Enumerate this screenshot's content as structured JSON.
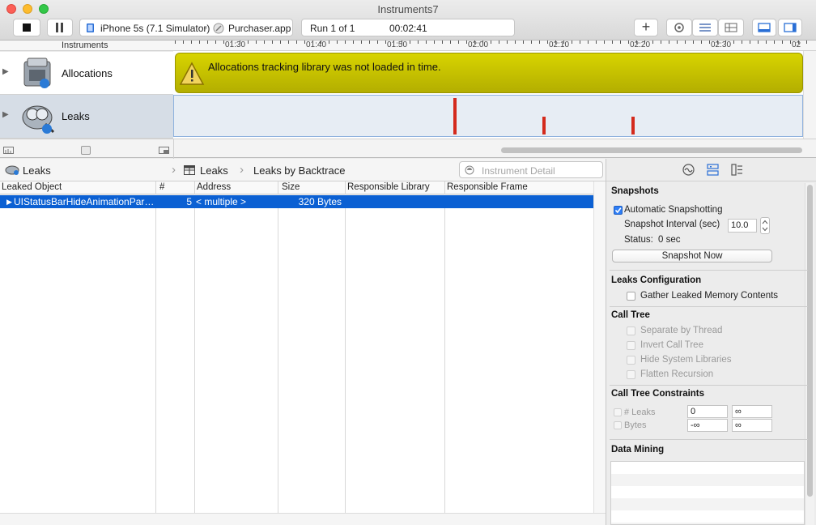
{
  "window": {
    "title": "Instruments7"
  },
  "toolbar": {
    "target_device": "iPhone 5s (7.1 Simulator)",
    "target_app": "Purchaser.app",
    "run_label": "Run 1 of 1",
    "run_time": "00:02:41",
    "add_label": "+"
  },
  "timeline": {
    "header_label": "Instruments",
    "ticks": [
      "01:30",
      "01:40",
      "01:50",
      "02:00",
      "02:10",
      "02:20",
      "02:30",
      "02"
    ]
  },
  "instruments": [
    {
      "name": "Allocations",
      "icon": "allocations-icon"
    },
    {
      "name": "Leaks",
      "icon": "leaks-icon"
    }
  ],
  "allocations_warning": "Allocations tracking library was not loaded in time.",
  "jumpbar": {
    "instrument": "Leaks",
    "view": "Leaks",
    "mode": "Leaks by Backtrace",
    "search_placeholder": "Instrument Detail"
  },
  "table": {
    "columns": [
      "Leaked Object",
      "#",
      "Address",
      "Size",
      "Responsible Library",
      "Responsible Frame"
    ],
    "rows": [
      {
        "object": "UIStatusBarHideAnimationPar…",
        "count": "5",
        "address": "< multiple >",
        "size": "320 Bytes",
        "library": "",
        "frame": ""
      }
    ]
  },
  "inspector": {
    "snapshots": {
      "title": "Snapshots",
      "auto_label": "Automatic Snapshotting",
      "auto_checked": true,
      "interval_label": "Snapshot Interval (sec)",
      "interval_value": "10.0",
      "status_label": "Status:",
      "status_value": "0 sec",
      "snapshot_button": "Snapshot Now"
    },
    "leaks_config": {
      "title": "Leaks Configuration",
      "gather_label": "Gather Leaked Memory Contents"
    },
    "call_tree": {
      "title": "Call Tree",
      "options": [
        "Separate by Thread",
        "Invert Call Tree",
        "Hide System Libraries",
        "Flatten Recursion"
      ]
    },
    "constraints": {
      "title": "Call Tree Constraints",
      "leaks_label": "# Leaks",
      "leaks_min": "0",
      "leaks_max": "∞",
      "bytes_label": "Bytes",
      "bytes_min": "-∞",
      "bytes_max": "∞"
    },
    "data_mining": {
      "title": "Data Mining"
    }
  },
  "colors": {
    "accent": "#0b60d3",
    "warning_banner": "#c2bd00",
    "leak_spike": "#d42a1c"
  }
}
